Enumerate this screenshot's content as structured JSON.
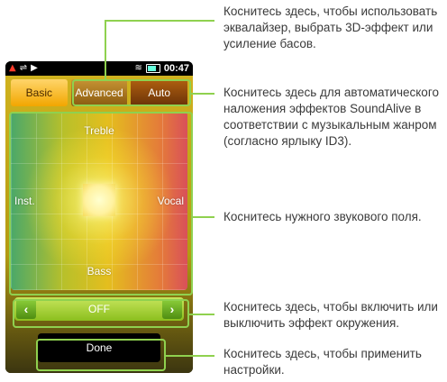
{
  "status_bar": {
    "left_icons": [
      "warning-icon",
      "usb-icon",
      "play-icon"
    ],
    "right_icons": [
      "wifi-icon",
      "battery-icon"
    ],
    "time": "00:47"
  },
  "tabs": [
    {
      "label": "Basic",
      "selected": true
    },
    {
      "label": "Advanced",
      "selected": false
    },
    {
      "label": "Auto",
      "selected": false
    }
  ],
  "field": {
    "top_label": "Treble",
    "bottom_label": "Bass",
    "left_label": "Inst.",
    "right_label": "Vocal"
  },
  "surround": {
    "prev_symbol": "‹",
    "value": "OFF",
    "next_symbol": "›"
  },
  "done_label": "Done",
  "callouts": {
    "tabs": "Коснитесь здесь, чтобы использовать эквалайзер, выбрать 3D-эффект или усиление басов.",
    "auto": "Коснитесь здесь для автоматического наложения эффектов SoundAlive в соответствии с музыкальным жанром (согласно ярлыку ID3).",
    "field": "Коснитесь нужного звукового поля.",
    "surround": "Коснитесь здесь, чтобы включить или выключить эффект окружения.",
    "done": "Коснитесь здесь, чтобы применить настройки."
  },
  "colors": {
    "callout_line": "#8fd14f",
    "basic_tab": "#f2a600",
    "surround_bar": "#8bbf1e"
  }
}
